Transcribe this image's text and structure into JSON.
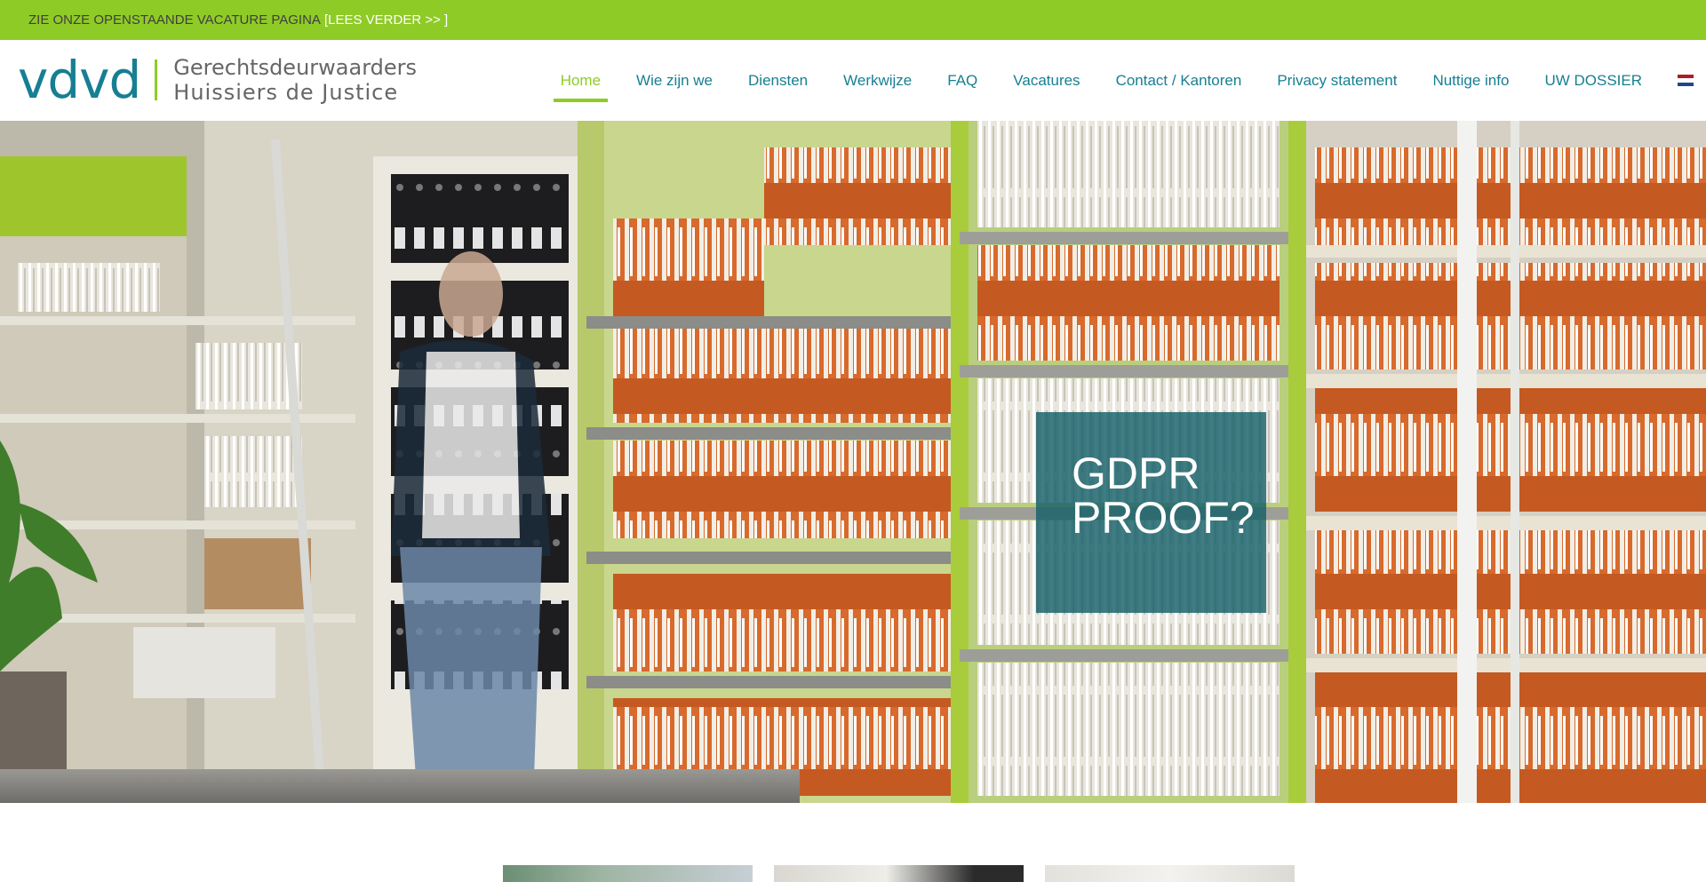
{
  "topbar": {
    "text": "ZIE ONZE OPENSTAANDE VACATURE PAGINA",
    "link": "[LEES VERDER >> ]",
    "bg_color": "#8fcb26"
  },
  "logo": {
    "mark": "vdvd",
    "line1": "Gerechtsdeurwaarders",
    "line2": "Huissiers de Justice",
    "brand_color": "#167f92",
    "accent_color": "#8fcb26"
  },
  "nav": {
    "items": [
      {
        "label": "Home",
        "active": true
      },
      {
        "label": "Wie zijn we"
      },
      {
        "label": "Diensten"
      },
      {
        "label": "Werkwijze"
      },
      {
        "label": "FAQ"
      },
      {
        "label": "Vacatures"
      },
      {
        "label": "Contact / Kantoren"
      },
      {
        "label": "Privacy statement"
      },
      {
        "label": "Nuttige info"
      },
      {
        "label": "UW DOSSIER"
      }
    ],
    "language_icon": "netherlands-flag-icon"
  },
  "hero": {
    "title_line1": "GDPR",
    "title_line2": "PROOF?"
  }
}
